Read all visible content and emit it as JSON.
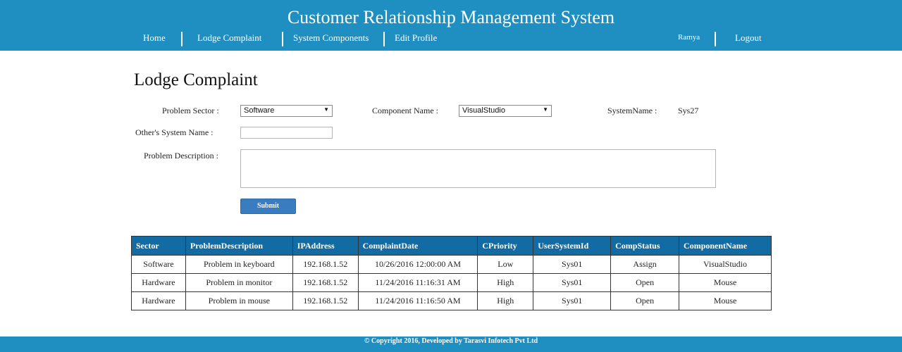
{
  "header": {
    "title": "Customer Relationship Management System",
    "nav": [
      "Home",
      "Lodge Complaint",
      "System Components",
      "Edit Profile"
    ],
    "user": "Ramya",
    "logout": "Logout"
  },
  "page": {
    "title": "Lodge Complaint"
  },
  "form": {
    "problem_sector_label": "Problem Sector :",
    "problem_sector_value": "Software",
    "component_name_label": "Component Name :",
    "component_name_value": "VisualStudio",
    "system_name_label": "SystemName :",
    "system_name_value": "Sys27",
    "others_system_label": "Other's System Name :",
    "others_system_value": "",
    "problem_description_label": "Problem Description :",
    "problem_description_value": "",
    "submit_label": "Submit"
  },
  "table": {
    "columns": [
      "Sector",
      "ProblemDescription",
      "IPAddress",
      "ComplaintDate",
      "CPriority",
      "UserSystemId",
      "CompStatus",
      "ComponentName"
    ],
    "rows": [
      [
        "Software",
        "Problem in keyboard",
        "192.168.1.52",
        "10/26/2016 12:00:00 AM",
        "Low",
        "Sys01",
        "Assign",
        "VisualStudio"
      ],
      [
        "Hardware",
        "Problem in monitor",
        "192.168.1.52",
        "11/24/2016 11:16:31 AM",
        "High",
        "Sys01",
        "Open",
        "Mouse"
      ],
      [
        "Hardware",
        "Problem in mouse",
        "192.168.1.52",
        "11/24/2016 11:16:50 AM",
        "High",
        "Sys01",
        "Open",
        "Mouse"
      ]
    ]
  },
  "footer": {
    "text": "© Copyright 2016, Developed by Tarasvi Infotech Pvt Ltd"
  },
  "colors": {
    "header_bg": "#1f8fc2",
    "table_header_bg": "#136ba3",
    "button_bg": "#3a7cc0"
  }
}
